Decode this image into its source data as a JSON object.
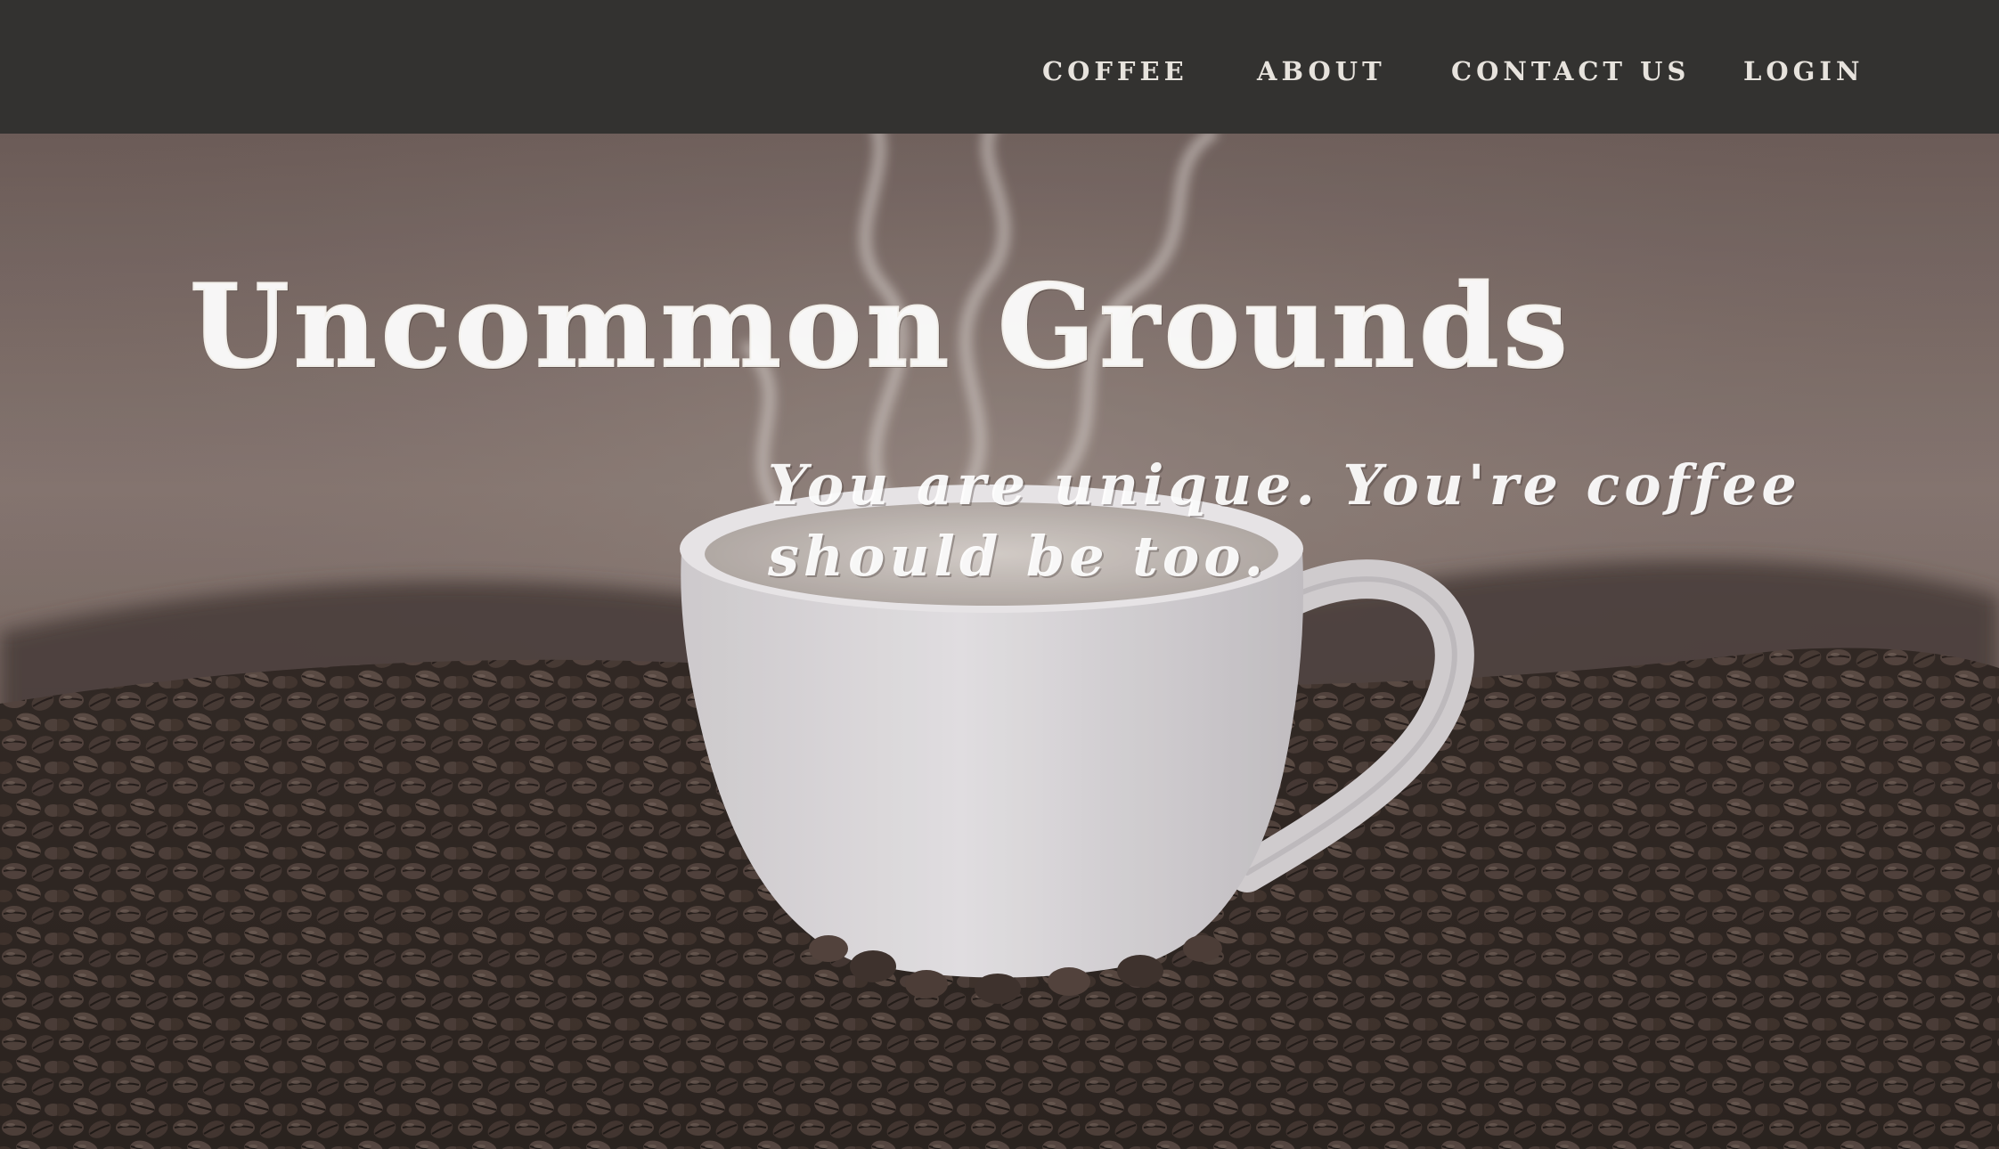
{
  "nav": {
    "items": [
      {
        "label": "COFFEE"
      },
      {
        "label": "ABOUT"
      },
      {
        "label": "CONTACT US"
      },
      {
        "label": "LOGIN"
      }
    ]
  },
  "hero": {
    "title": "Uncommon Grounds",
    "tagline": "You are unique. You're coffee should be too.",
    "image": "coffee-cup-on-beans-photo"
  },
  "colors": {
    "navbar_bg": "#333230",
    "nav_text": "#e7e3dd",
    "hero_text": "#ffffff"
  }
}
